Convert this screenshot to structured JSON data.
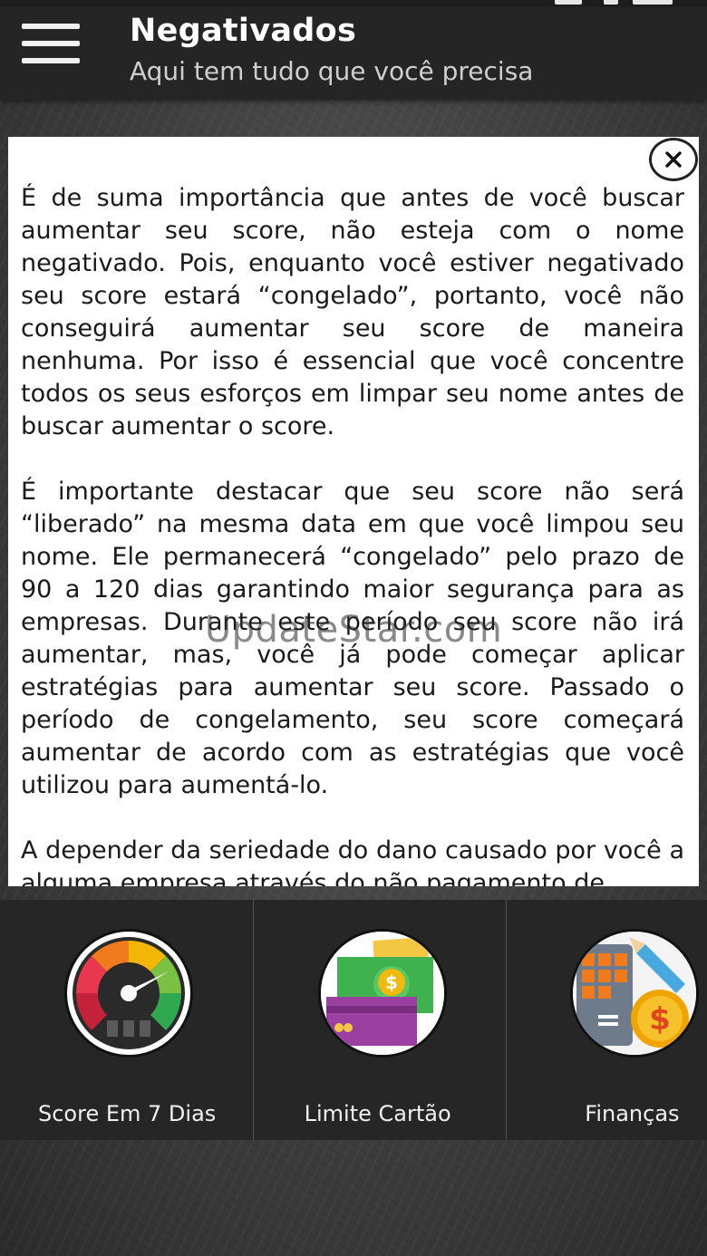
{
  "header": {
    "title": "Negativados",
    "subtitle": "Aqui tem tudo que você precisa"
  },
  "dialog": {
    "paragraphs": [
      "É de suma importância que antes de você buscar aumentar seu score, não esteja com o nome negativado. Pois, enquanto você estiver negativado seu score estará “congelado”, portanto, você não conseguirá aumentar seu score de maneira nenhuma. Por isso é essencial que você concentre todos os seus esforços em limpar seu nome antes de buscar aumentar o score.",
      "É importante destacar que seu score não será “liberado” na mesma data em que você limpou seu nome. Ele permanecerá “congelado” pelo prazo de 90 a 120 dias garantindo maior segurança para as empresas. Durante este período seu score não irá aumentar, mas, você já pode começar aplicar estratégias para aumentar seu score. Passado o período de congelamento, seu score começará aumentar de acordo com as estratégias que você utilizou para aumentá-lo.",
      "A depender da seriedade do dano causado por você a alguma empresa através do não pagamento de"
    ]
  },
  "watermark": "UpdateStar.com",
  "bottom_menu": [
    {
      "label": "Score Em 7 Dias",
      "icon": "speedometer-icon"
    },
    {
      "label": "Limite Cartão",
      "icon": "money-card-icon"
    },
    {
      "label": "Finanças",
      "icon": "calculator-coin-icon"
    }
  ],
  "colors": {
    "app_bar": "#252525",
    "dialog_bg": "#ffffff",
    "panel_bg": "#262626"
  }
}
